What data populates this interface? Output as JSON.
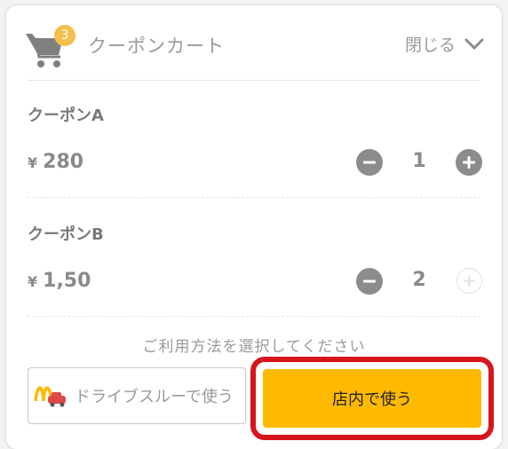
{
  "header": {
    "cart_count": "3",
    "title": "クーポンカート",
    "close_label": "閉じる"
  },
  "coupons": [
    {
      "name": "クーポンA",
      "currency": "¥",
      "price": "280",
      "quantity": "1",
      "plus_enabled": true
    },
    {
      "name": "クーポンB",
      "currency": "¥",
      "price": "1,50",
      "quantity": "2",
      "plus_enabled": false
    }
  ],
  "instruction": "ご利用方法を選択してください",
  "actions": {
    "drive_thru_label": "ドライブスルーで使う",
    "in_store_label": "店内で使う"
  },
  "colors": {
    "badge": "#f4c04c",
    "primary_button": "#ffb900",
    "highlight_frame": "#d8141d",
    "stepper": "#8c8c8c",
    "text_muted": "#9a9a9a"
  },
  "icons": {
    "cart": "cart-icon",
    "close": "chevron-down-icon",
    "minus": "minus-icon",
    "plus": "plus-icon",
    "drive_thru": "mcdonalds-drive-thru-icon"
  }
}
